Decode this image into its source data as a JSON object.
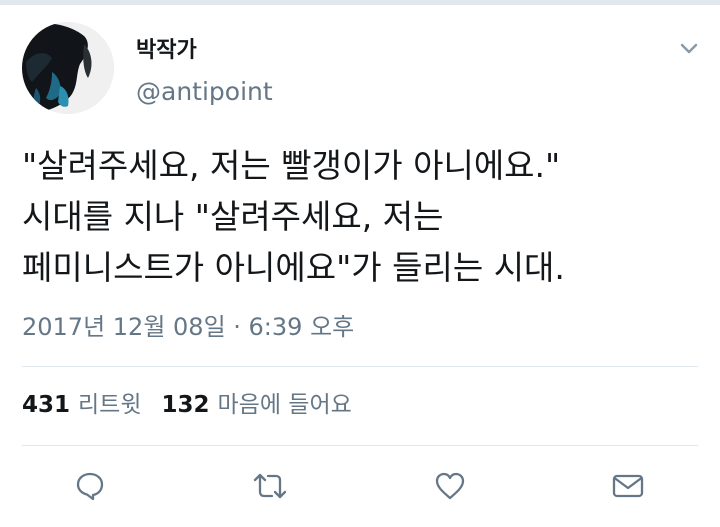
{
  "user": {
    "display_name": "박작가",
    "handle": "@antipoint"
  },
  "tweet": {
    "lines": [
      "\"살려주세요, 저는 빨갱이가 아니에요.\"",
      "시대를 지나 \"살려주세요, 저는",
      "페미니스트가 아니에요\"가 들리는 시대."
    ],
    "timestamp": "2017년 12월 08일 · 6:39 오후"
  },
  "stats": {
    "retweets": {
      "count": "431",
      "label": "리트윗"
    },
    "likes": {
      "count": "132",
      "label": "마음에 들어요"
    }
  },
  "actions": [
    {
      "icon": "reply-icon"
    },
    {
      "icon": "retweet-icon"
    },
    {
      "icon": "like-icon"
    },
    {
      "icon": "direct-message-icon"
    }
  ],
  "colors": {
    "text_primary": "#14171a",
    "text_secondary": "#657786",
    "divider": "#e1e8ed"
  }
}
